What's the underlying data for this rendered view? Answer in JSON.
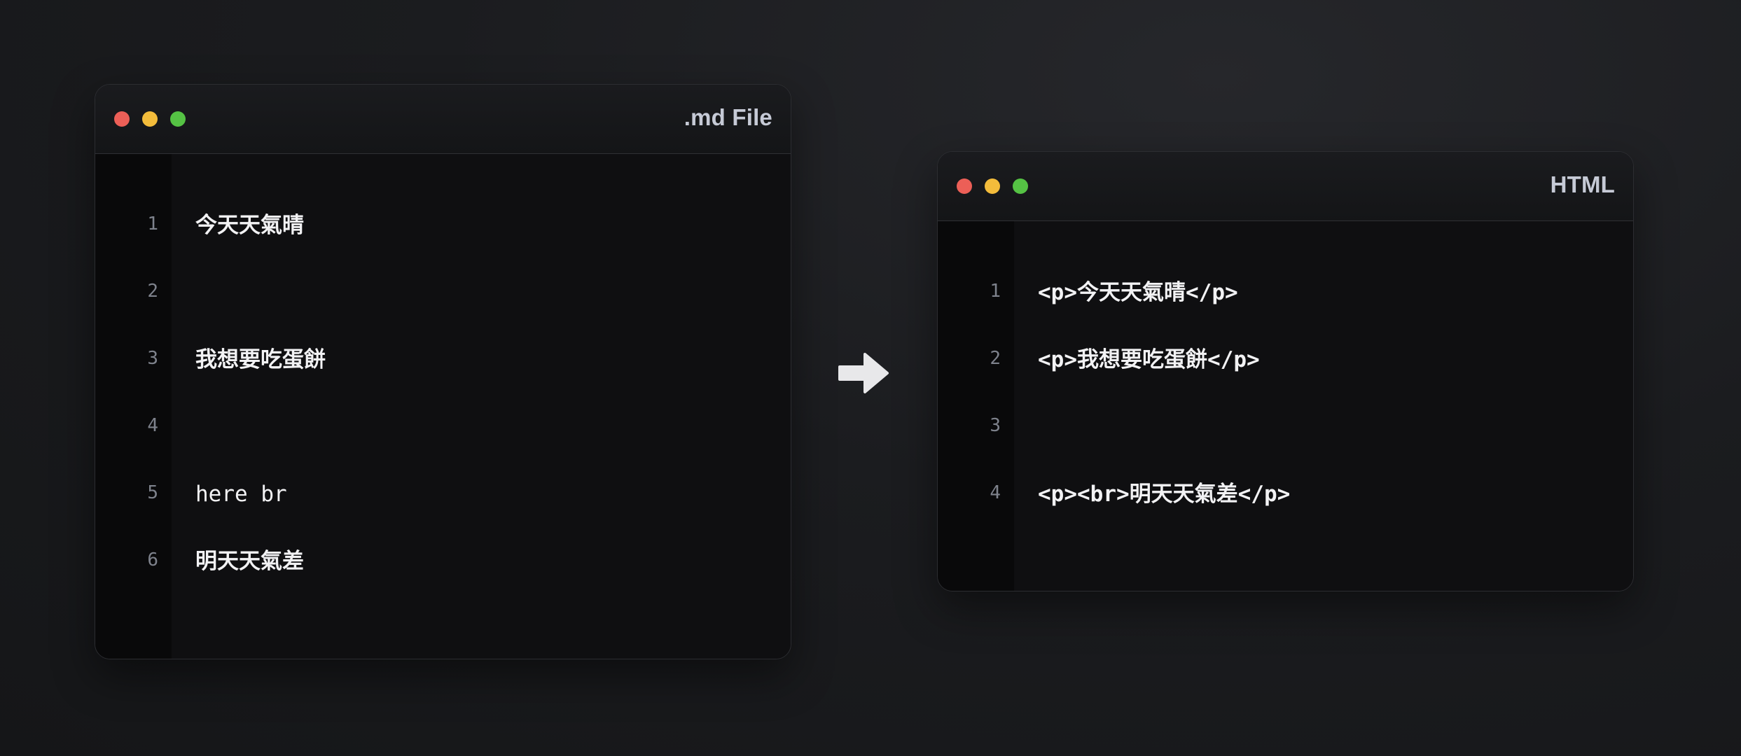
{
  "md_window": {
    "title": ".md File",
    "lines": [
      {
        "num": "1",
        "text": "今天天氣晴"
      },
      {
        "num": "2",
        "text": ""
      },
      {
        "num": "3",
        "text": "我想要吃蛋餅"
      },
      {
        "num": "4",
        "text": ""
      },
      {
        "num": "5",
        "text": "here br"
      },
      {
        "num": "6",
        "text": "明天天氣差"
      }
    ]
  },
  "html_window": {
    "title": "HTML",
    "lines": [
      {
        "num": "1",
        "text": "<p>今天天氣晴</p>"
      },
      {
        "num": "2",
        "text": "<p>我想要吃蛋餅</p>"
      },
      {
        "num": "3",
        "text": ""
      },
      {
        "num": "4",
        "text": "<p><br>明天天氣差</p>"
      }
    ]
  },
  "arrow_icon": "right-arrow-icon",
  "colors": {
    "close": "#ec5f57",
    "minimize": "#f3bc3b",
    "maximize": "#55c244",
    "title_text": "#c6cad6"
  }
}
